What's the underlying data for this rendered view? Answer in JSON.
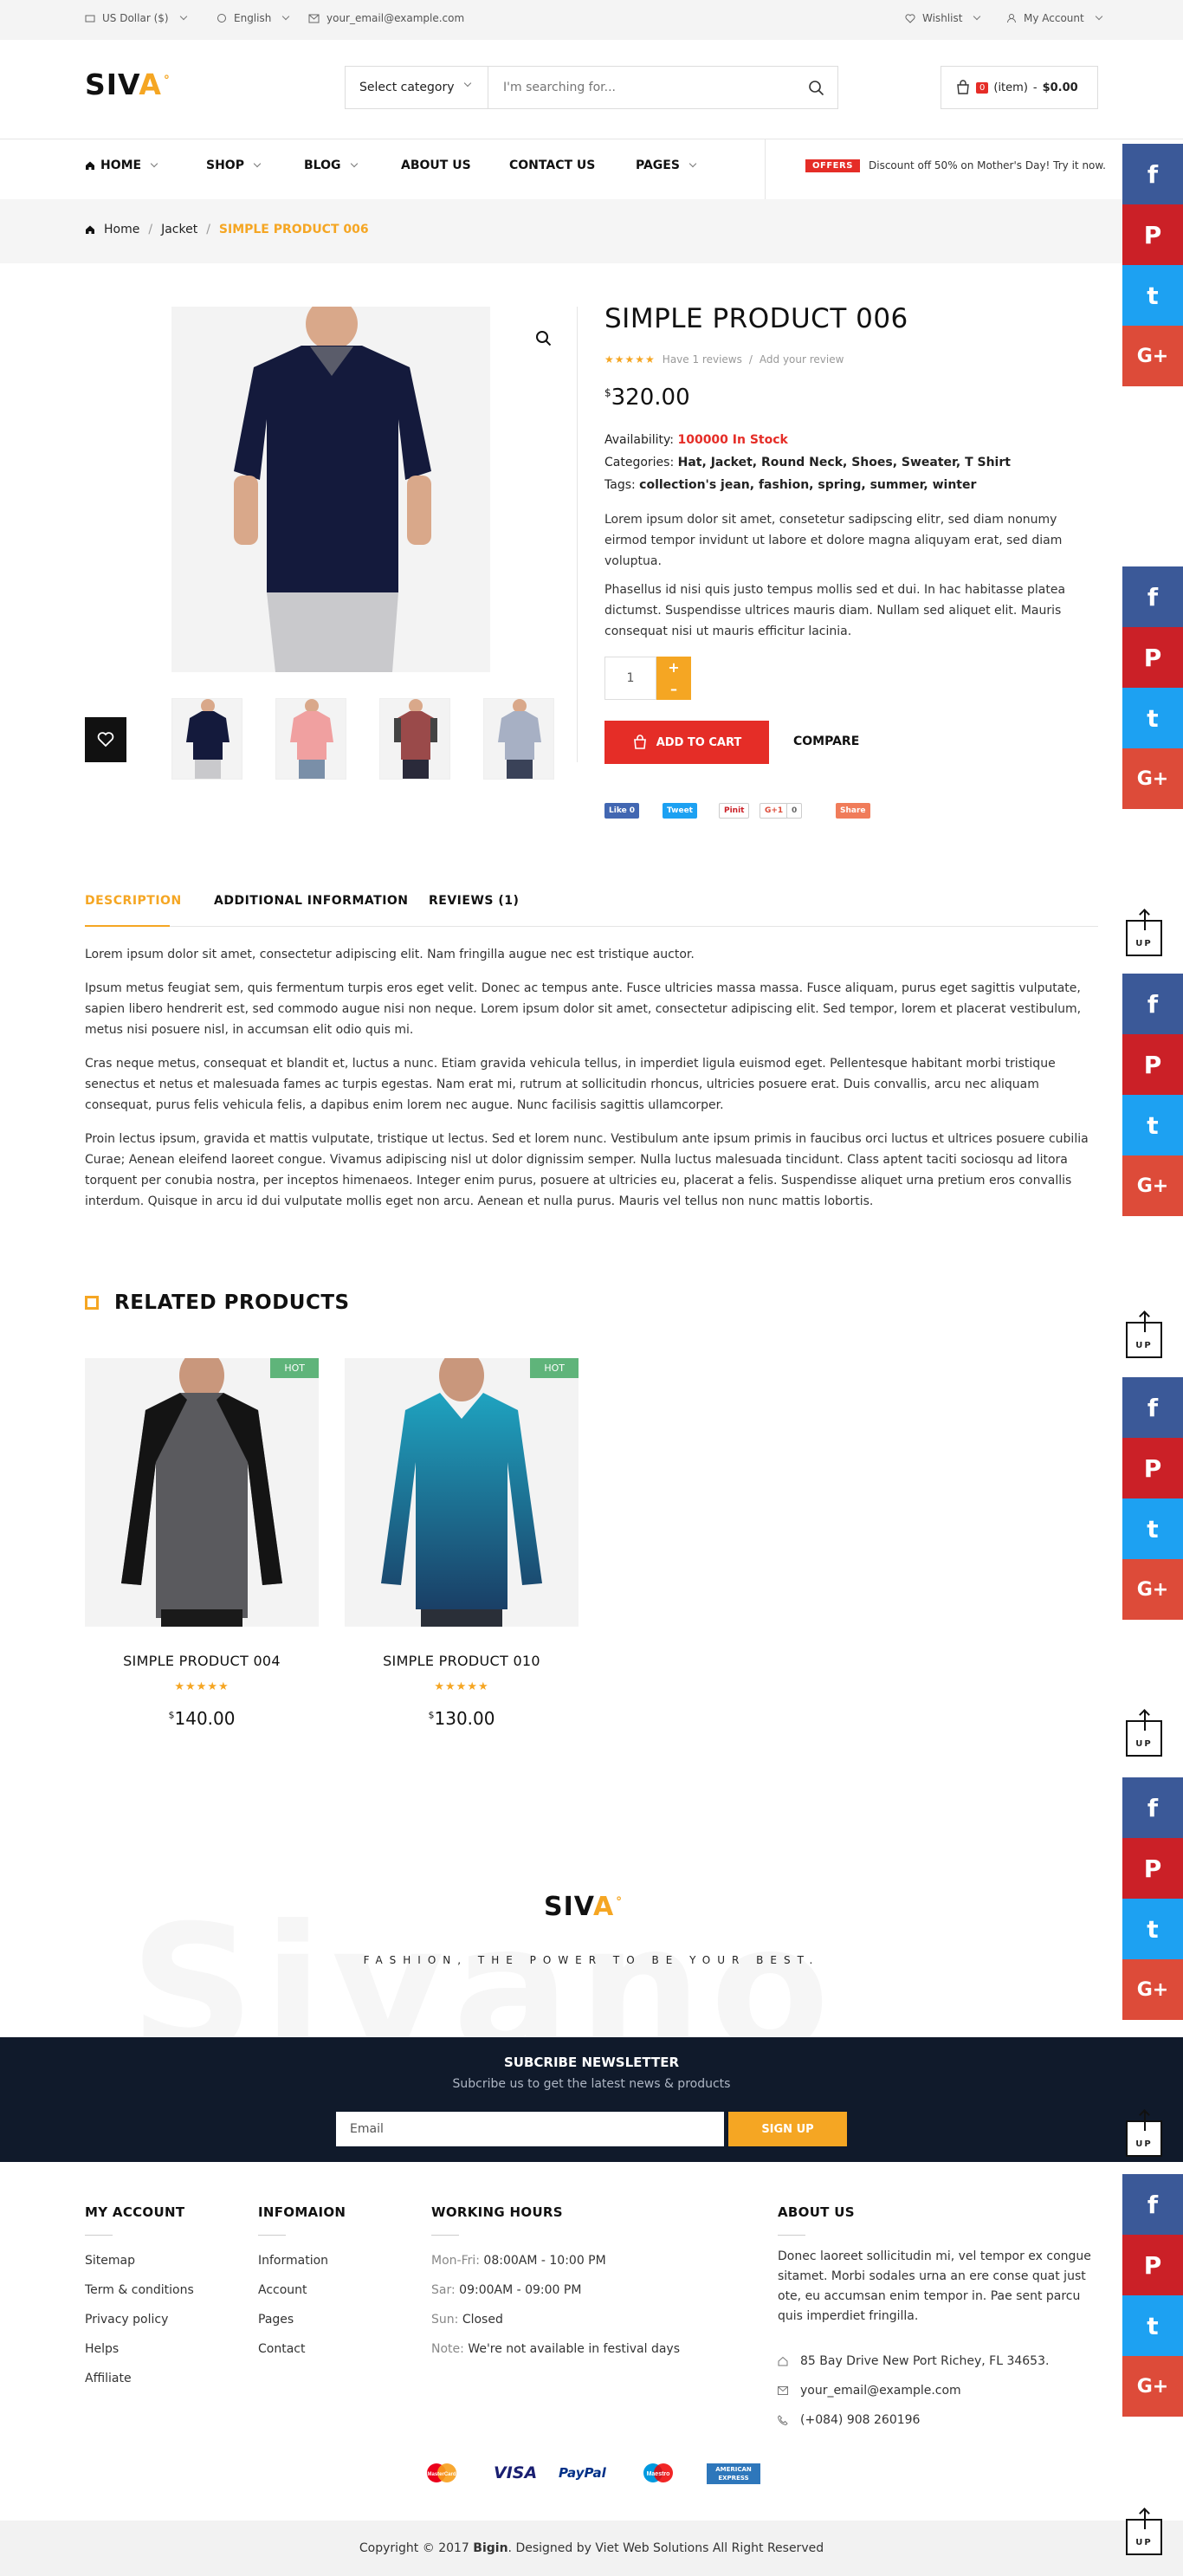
{
  "topbar": {
    "currency": "US Dollar ($)",
    "language": "English",
    "email": "your_email@example.com",
    "wishlist": "Wishlist",
    "account": "My Account"
  },
  "header": {
    "logo_text": "SIVA",
    "logo_a": "A",
    "logo_dot": "°",
    "category_select": "Select category",
    "search_placeholder": "I'm searching for...",
    "cart_count": "0",
    "cart_items": "(item)",
    "cart_total": "$0.00"
  },
  "nav": {
    "items": [
      "HOME",
      "SHOP",
      "BLOG",
      "ABOUT US",
      "CONTACT US",
      "PAGES"
    ],
    "offer_badge": "OFFERS",
    "offer_text": "Discount off 50% on Mother's Day! Try it now."
  },
  "breadcrumb": {
    "home": "Home",
    "category": "Jacket",
    "current": "SIMPLE PRODUCT 006"
  },
  "product": {
    "title": "SIMPLE PRODUCT 006",
    "rating_stars": "★★★★★",
    "reviews_link": "Have 1 reviews",
    "add_review": "Add your review",
    "price_symbol": "$",
    "price": "320.00",
    "availability_label": "Availability:",
    "availability": "100000 In Stock",
    "categories_label": "Categories:",
    "categories": "Hat, Jacket, Round Neck, Shoes, Sweater, T Shirt",
    "tags_label": "Tags:",
    "tags": "collection's jean, fashion, spring, summer, winter",
    "desc1": "Lorem ipsum dolor sit amet, consetetur sadipscing elitr, sed diam nonumy eirmod tempor invidunt ut labore et dolore magna aliquyam erat, sed diam voluptua.",
    "desc2": "Phasellus id nisi quis justo tempus mollis sed et dui. In hac habitasse platea dictumst. Suspendisse ultrices mauris diam. Nullam sed aliquet elit. Mauris consequat nisi ut mauris efficitur lacinia.",
    "quantity": "1",
    "qty_plus": "+",
    "qty_minus": "–",
    "add_to_cart": "ADD TO CART",
    "compare": "COMPARE",
    "share": {
      "fb": "Like 0",
      "tw": "Tweet",
      "pin": "Pinit",
      "gp": "G+1",
      "gp_count": "0",
      "share": "Share"
    }
  },
  "tabs": [
    "DESCRIPTION",
    "ADDITIONAL INFORMATION",
    "REVIEWS (1)"
  ],
  "description": [
    "Lorem ipsum dolor sit amet, consectetur adipiscing elit. Nam fringilla augue nec est tristique auctor.",
    "Ipsum metus feugiat sem, quis fermentum turpis eros eget velit. Donec ac tempus ante. Fusce ultricies massa massa. Fusce aliquam, purus eget sagittis vulputate, sapien libero hendrerit est, sed commodo augue nisi non neque. Lorem ipsum dolor sit amet, consectetur adipiscing elit. Sed tempor, lorem et placerat vestibulum, metus nisi posuere nisl, in accumsan elit odio quis mi.",
    "Cras neque metus, consequat et blandit et, luctus a nunc. Etiam gravida vehicula tellus, in imperdiet ligula euismod eget. Pellentesque habitant morbi tristique senectus et netus et malesuada fames ac turpis egestas. Nam erat mi, rutrum at sollicitudin rhoncus, ultricies posuere erat. Duis convallis, arcu nec aliquam consequat, purus felis vehicula felis, a dapibus enim lorem nec augue. Nunc facilisis sagittis ullamcorper.",
    "Proin lectus ipsum, gravida et mattis vulputate, tristique ut lectus. Sed et lorem nunc. Vestibulum ante ipsum primis in faucibus orci luctus et ultrices posuere cubilia Curae; Aenean eleifend laoreet congue. Vivamus adipiscing nisl ut dolor dignissim semper. Nulla luctus malesuada tincidunt. Class aptent taciti sociosqu ad litora torquent per conubia nostra, per inceptos himenaeos. Integer enim purus, posuere at ultricies eu, placerat a felis. Suspendisse aliquet urna pretium eros convallis interdum. Quisque in arcu id dui vulputate mollis eget non arcu. Aenean et nulla purus. Mauris vel tellus non nunc mattis lobortis."
  ],
  "related": {
    "heading": "RELATED PRODUCTS",
    "items": [
      {
        "badge": "HOT",
        "name": "SIMPLE PRODUCT 004",
        "stars": "★★★★★",
        "price_symbol": "$",
        "price": "140.00"
      },
      {
        "badge": "HOT",
        "name": "SIMPLE PRODUCT 010",
        "stars": "★★★★★",
        "price_symbol": "$",
        "price": "130.00"
      }
    ]
  },
  "brand": {
    "bg_word": "Sivano",
    "slogan": "FASHION, THE POWER TO BE YOUR BEST."
  },
  "newsletter": {
    "title": "SUBCRIBE NEWSLETTER",
    "subtitle": "Subcribe us to get the latest news & products",
    "email_placeholder": "Email",
    "button": "SIGN UP"
  },
  "footer": {
    "account": {
      "title": "MY ACCOUNT",
      "links": [
        "Sitemap",
        "Term & conditions",
        "Privacy policy",
        "Helps",
        "Affiliate"
      ]
    },
    "info": {
      "title": "INFOMAION",
      "links": [
        "Information",
        "Account",
        "Pages",
        "Contact"
      ]
    },
    "hours": {
      "title": "WORKING HOURS",
      "rows": [
        {
          "label": "Mon-Fri:",
          "value": "08:00AM - 10:00 PM"
        },
        {
          "label": "Sar:",
          "value": "09:00AM - 09:00 PM"
        },
        {
          "label": "Sun:",
          "value": "Closed"
        },
        {
          "label": "Note:",
          "value": "We're not available in festival days"
        }
      ]
    },
    "about": {
      "title": "ABOUT US",
      "text": "Donec laoreet sollicitudin mi, vel tempor ex congue sitamet. Morbi sodales urna an ere conse quat just ote, eu accumsan enim tempor in. Pae sent parcu quis imperdiet fringilla.",
      "address": "85 Bay Drive New Port Richey, FL 34653.",
      "email": "your_email@example.com",
      "phone": "(+084) 908 260196"
    },
    "payments": [
      "MasterCard",
      "VISA",
      "PayPal",
      "Maestro",
      "AMERICAN EXPRESS"
    ],
    "copyright_pre": "Copyright © 2017",
    "copyright_brand": "Bigin",
    "copyright_post": ". Designed by Viet Web Solutions All Right Reserved"
  },
  "social": {
    "fb": "f",
    "pi": "P",
    "tw": "t",
    "gp": "G+",
    "up": "UP"
  },
  "colors": {
    "accent": "#f5a623",
    "red": "#e52d27",
    "newsletter_bg": "#101a2b",
    "facebook": "#3b5998",
    "pinterest": "#cb2027",
    "twitter": "#1da1f2",
    "googleplus": "#dd4b39"
  }
}
